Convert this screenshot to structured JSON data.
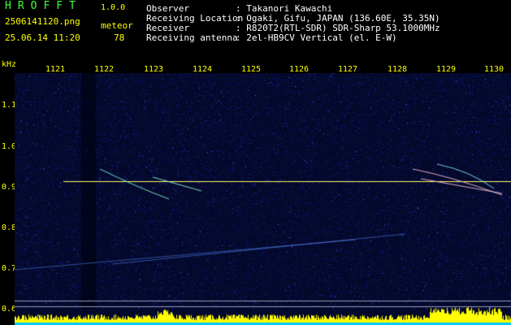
{
  "header": {
    "app_title": "HROFFT",
    "version": "1.0.0",
    "filename": "2506141120.png",
    "datetime": "25.06.14 11:20",
    "meteor_label": "meteor",
    "meteor_count": "78",
    "info": [
      {
        "label": "Observer",
        "value": ": Takanori Kawachi"
      },
      {
        "label": "Receiving Location",
        "value": ": Ogaki, Gifu, JAPAN (136.60E, 35.35N)"
      },
      {
        "label": "Receiver",
        "value": ": R820T2(RTL-SDR) SDR-Sharp 53.1000MHz"
      },
      {
        "label": "Receiving antenna",
        "value": ": 2el-HB9CV Vertical (el. E-W)"
      }
    ]
  },
  "axis": {
    "y_unit": "kHz",
    "x_ticks": [
      "1121",
      "1122",
      "1123",
      "1124",
      "1125",
      "1126",
      "1127",
      "1128",
      "1129",
      "1130"
    ],
    "y_ticks": [
      "1.1",
      "1.0",
      "0.9",
      "0.8",
      "0.7",
      "0.6"
    ]
  },
  "colors": {
    "header_yellow": "#ffff00",
    "header_green": "#3cff3c",
    "carrier_line": "#ffff66",
    "noise_blue": "#1a2aa0",
    "power_bar": "#ffff00",
    "power_base": "#00c8ff"
  }
}
